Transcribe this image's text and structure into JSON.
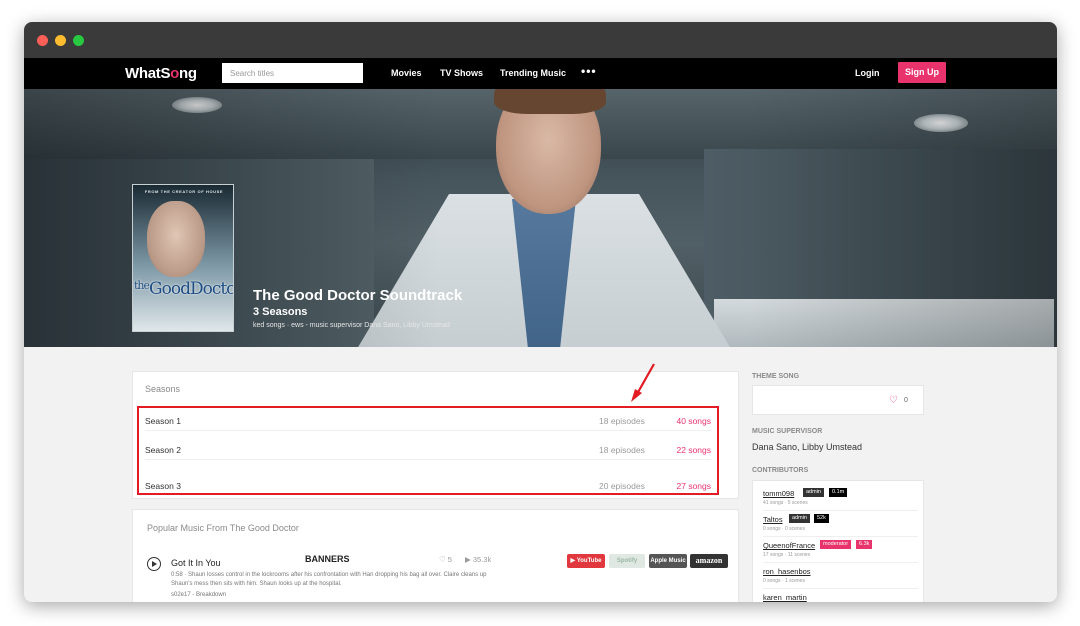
{
  "window": {
    "controls": [
      "close",
      "minimize",
      "zoom"
    ]
  },
  "nav": {
    "logo": {
      "pre": "WhatS",
      "o": "o",
      "post": "ng"
    },
    "search_placeholder": "Search titles",
    "links": [
      "Movies",
      "TV Shows",
      "Trending Music"
    ],
    "more": "•••",
    "login": "Login",
    "signup": "Sign Up"
  },
  "hero": {
    "poster": {
      "tag": "FROM THE CREATOR OF HOUSE",
      "title_a": "Good",
      "title_b": "Doctor",
      "title_prefix": "the"
    },
    "title": "The Good Doctor Soundtrack",
    "seasons": "3 Seasons",
    "meta": "ked songs · ews - music supervisor Dana Sano, Libby Umstead"
  },
  "seasons": {
    "heading": "Seasons",
    "rows": [
      {
        "name": "Season 1",
        "episodes": "18 episodes",
        "songs": "40 songs"
      },
      {
        "name": "Season 2",
        "episodes": "18 episodes",
        "songs": "22 songs"
      },
      {
        "name": "Season 3",
        "episodes": "20 episodes",
        "songs": "27 songs"
      }
    ]
  },
  "popular": {
    "heading": "Popular Music From The Good Doctor",
    "song": {
      "title": "Got It In You",
      "artist": "BANNERS",
      "likes": "♡ 5",
      "plays": "▶ 35.3k",
      "description": "0:58 · Shaun losses control in the lockrooms after his confrontation with Han dropping his bag all over. Claire cleans up Shaun's mess then sits with him. Shaun looks up at the hospital.",
      "episode": "s02e17 - Breakdown"
    },
    "stores": [
      "▶ YouTube",
      "Spotify",
      " Apple Music",
      "amazon"
    ]
  },
  "sidebar": {
    "theme_label": "THEME SONG",
    "theme_heart": "♡",
    "theme_count": "0",
    "supervisor_label": "MUSIC SUPERVISOR",
    "supervisor": "Dana Sano, Libby Umstead",
    "contributors_label": "CONTRIBUTORS",
    "contributors": [
      {
        "name": "tomm098",
        "stats": "41 songs · 5 scenes",
        "role": "admin",
        "value": "0.1m"
      },
      {
        "name": "Taltos",
        "stats": "0 songs · 0 scenes",
        "role": "admin",
        "value": "52k"
      },
      {
        "name": "QueenofFrance",
        "stats": "17 songs · 11 scenes",
        "role": "moderator",
        "value": "6.3k"
      },
      {
        "name": "ron_hasenbos",
        "stats": "0 songs · 1 scenes",
        "role": "",
        "value": ""
      },
      {
        "name": "karen_martin",
        "stats": "",
        "role": "",
        "value": ""
      }
    ]
  },
  "colors": {
    "accent": "#e8336d",
    "highlight": "#e31b23",
    "navbar": "#000000"
  }
}
